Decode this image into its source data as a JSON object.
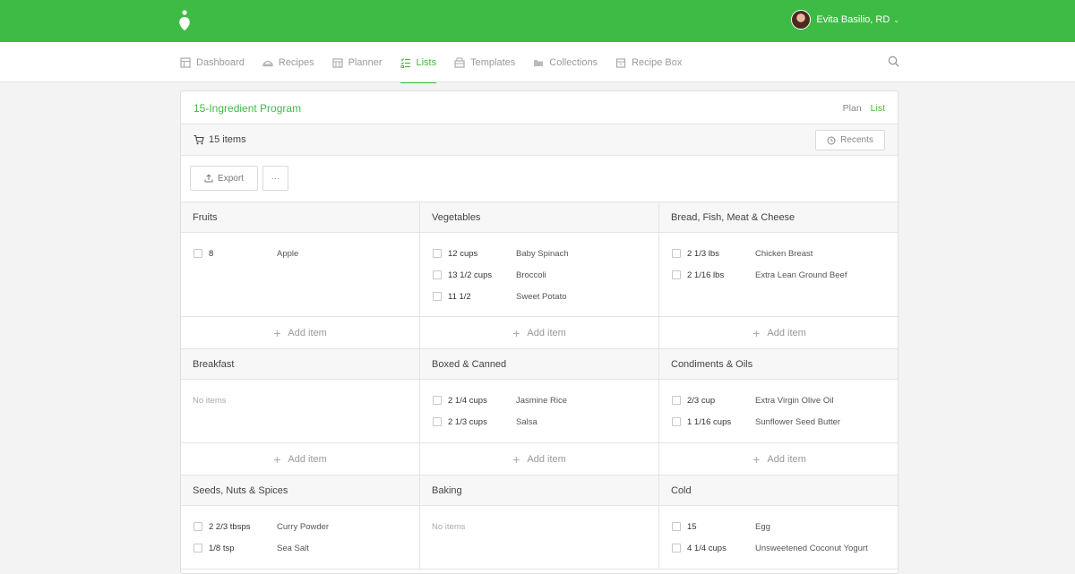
{
  "header": {
    "user_name": "Evita Basilio, RD",
    "caret": "⌄"
  },
  "nav": [
    {
      "label": "Dashboard",
      "icon": "dashboard-icon",
      "active": false
    },
    {
      "label": "Recipes",
      "icon": "recipes-icon",
      "active": false
    },
    {
      "label": "Planner",
      "icon": "calendar-icon",
      "active": false
    },
    {
      "label": "Lists",
      "icon": "list-icon",
      "active": true
    },
    {
      "label": "Templates",
      "icon": "templates-icon",
      "active": false
    },
    {
      "label": "Collections",
      "icon": "folder-icon",
      "active": false
    },
    {
      "label": "Recipe Box",
      "icon": "box-icon",
      "active": false
    }
  ],
  "program": {
    "title": "15-Ingredient Program",
    "tabs": [
      {
        "label": "Plan",
        "active": false
      },
      {
        "label": "List",
        "active": true
      }
    ],
    "items_count": "15 items",
    "recents_label": "Recents",
    "export_label": "Export",
    "more_label": "···"
  },
  "add_item_label": "Add item",
  "no_items_label": "No items",
  "categories": [
    {
      "name": "Fruits",
      "items": [
        {
          "qty": "8",
          "name": "Apple"
        }
      ]
    },
    {
      "name": "Vegetables",
      "items": [
        {
          "qty": "12 cups",
          "name": "Baby Spinach"
        },
        {
          "qty": "13 1/2 cups",
          "name": "Broccoli"
        },
        {
          "qty": "11 1/2",
          "name": "Sweet Potato"
        }
      ]
    },
    {
      "name": "Bread, Fish, Meat & Cheese",
      "items": [
        {
          "qty": "2 1/3 lbs",
          "name": "Chicken Breast"
        },
        {
          "qty": "2 1/16 lbs",
          "name": "Extra Lean Ground Beef"
        }
      ]
    },
    {
      "name": "Breakfast",
      "items": []
    },
    {
      "name": "Boxed & Canned",
      "items": [
        {
          "qty": "2 1/4 cups",
          "name": "Jasmine Rice"
        },
        {
          "qty": "2 1/3 cups",
          "name": "Salsa"
        }
      ]
    },
    {
      "name": "Condiments & Oils",
      "items": [
        {
          "qty": "2/3 cup",
          "name": "Extra Virgin Olive Oil"
        },
        {
          "qty": "1 1/16 cups",
          "name": "Sunflower Seed Butter"
        }
      ]
    },
    {
      "name": "Seeds, Nuts & Spices",
      "items": [
        {
          "qty": "2 2/3 tbsps",
          "name": "Curry Powder"
        },
        {
          "qty": "1/8 tsp",
          "name": "Sea Salt"
        }
      ]
    },
    {
      "name": "Baking",
      "items": []
    },
    {
      "name": "Cold",
      "items": [
        {
          "qty": "15",
          "name": "Egg"
        },
        {
          "qty": "4 1/4 cups",
          "name": "Unsweetened Coconut Yogurt"
        }
      ]
    }
  ],
  "colors": {
    "brand_green": "#3ebb45",
    "background": "#f3f3f3"
  }
}
